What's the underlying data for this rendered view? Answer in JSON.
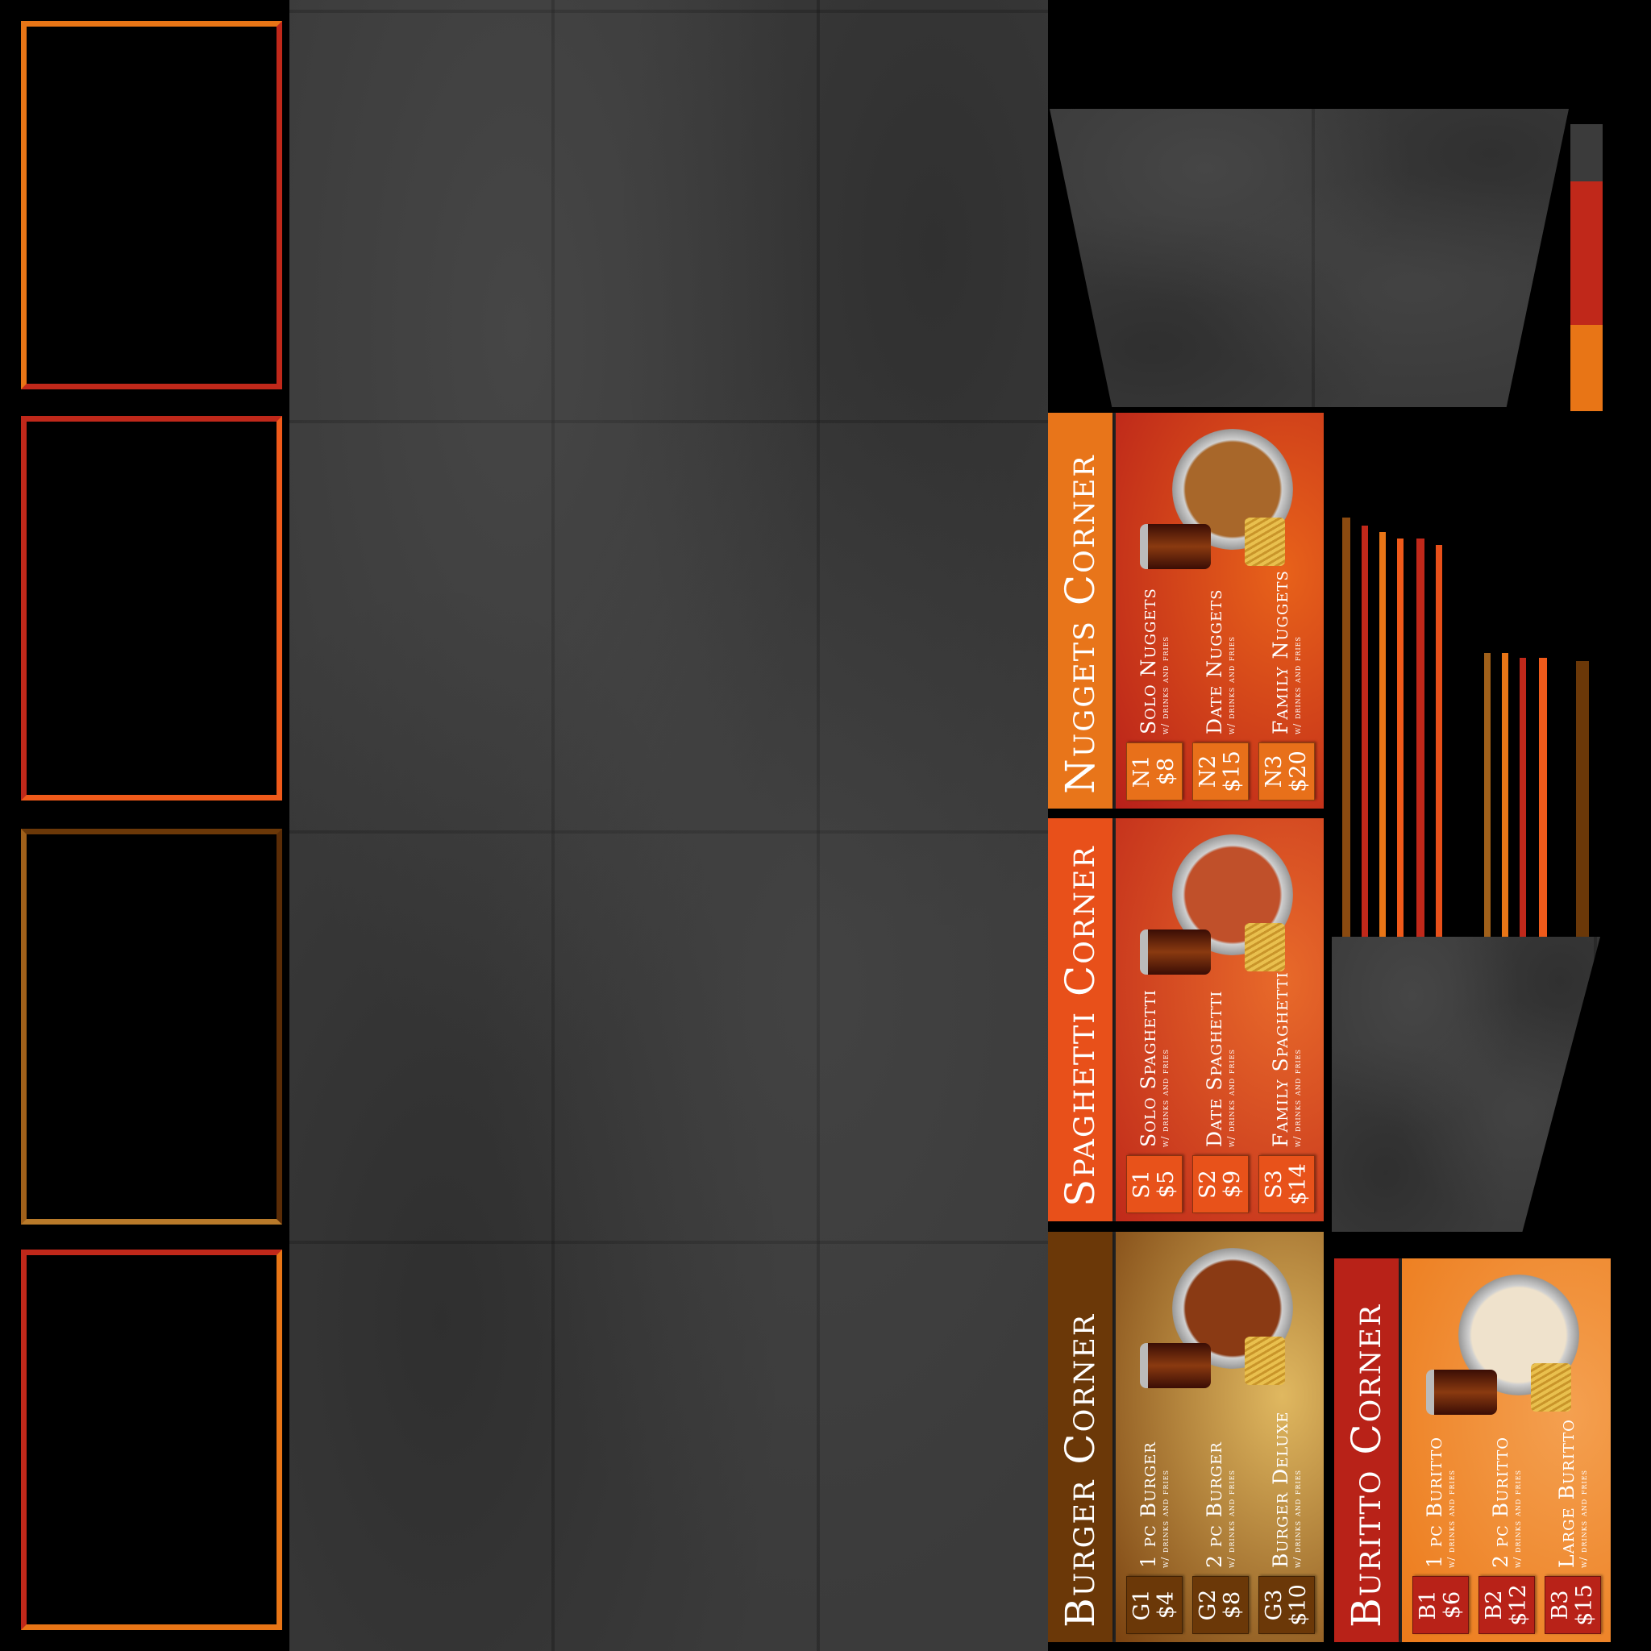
{
  "atlas_title": "Food court menu board texture atlas",
  "colors": {
    "concrete": "#3b3b3b",
    "orange": "#e87516",
    "red": "#b82218",
    "brown": "#6b3808"
  },
  "panels": [
    {
      "id": "nuggets",
      "title": "Nuggets Corner",
      "header_color": "#e8751a",
      "body_gradient": [
        "#b8201a",
        "#e8621a"
      ],
      "box_color": "#e8701a",
      "food": "nuggets-plate-icon",
      "items": [
        {
          "code": "N1",
          "price": "$8",
          "name": "Solo Nuggets",
          "subtitle": "w/ drinks and fries"
        },
        {
          "code": "N2",
          "price": "$15",
          "name": "Date Nuggets",
          "subtitle": "w/ drinks and fries"
        },
        {
          "code": "N3",
          "price": "$20",
          "name": "Family Nuggets",
          "subtitle": "w/ drinks and fries"
        }
      ]
    },
    {
      "id": "spaghetti",
      "title": "Spaghetti Corner",
      "header_color": "#e8501a",
      "body_gradient": [
        "#c02a1a",
        "#e86a2a"
      ],
      "box_color": "#e8521a",
      "food": "spaghetti-plate-icon",
      "items": [
        {
          "code": "S1",
          "price": "$5",
          "name": "Solo Spaghetti",
          "subtitle": "w/ drinks and fries"
        },
        {
          "code": "S2",
          "price": "$9",
          "name": "Date Spaghetti",
          "subtitle": "w/ drinks and fries"
        },
        {
          "code": "S3",
          "price": "$14",
          "name": "Family Spaghetti",
          "subtitle": "w/ drinks and fries"
        }
      ]
    },
    {
      "id": "burger",
      "title": "Burger Corner",
      "header_color": "#6b3808",
      "body_gradient": [
        "#7a4210",
        "#e0b860"
      ],
      "box_color": "#6b3808",
      "food": "burger-icon",
      "items": [
        {
          "code": "G1",
          "price": "$4",
          "name": "1 pc Burger",
          "subtitle": "w/ drinks and fries"
        },
        {
          "code": "G2",
          "price": "$8",
          "name": "2 pc Burger",
          "subtitle": "w/ drinks and fries"
        },
        {
          "code": "G3",
          "price": "$10",
          "name": "Burger Deluxe",
          "subtitle": "w/ drinks and fries"
        }
      ]
    },
    {
      "id": "buritto",
      "title": "Buritto Corner",
      "header_color": "#b82218",
      "body_gradient": [
        "#ec7a1a",
        "#f4a050"
      ],
      "box_color": "#b82218",
      "food": "buritto-icon",
      "items": [
        {
          "code": "B1",
          "price": "$6",
          "name": "1 pc Buritto",
          "subtitle": "w/ drinks and fries"
        },
        {
          "code": "B2",
          "price": "$12",
          "name": "2 pc Buritto",
          "subtitle": "w/ drinks and fries"
        },
        {
          "code": "B3",
          "price": "$15",
          "name": "Large Buritto",
          "subtitle": "w/ drinks and fries"
        }
      ]
    }
  ]
}
